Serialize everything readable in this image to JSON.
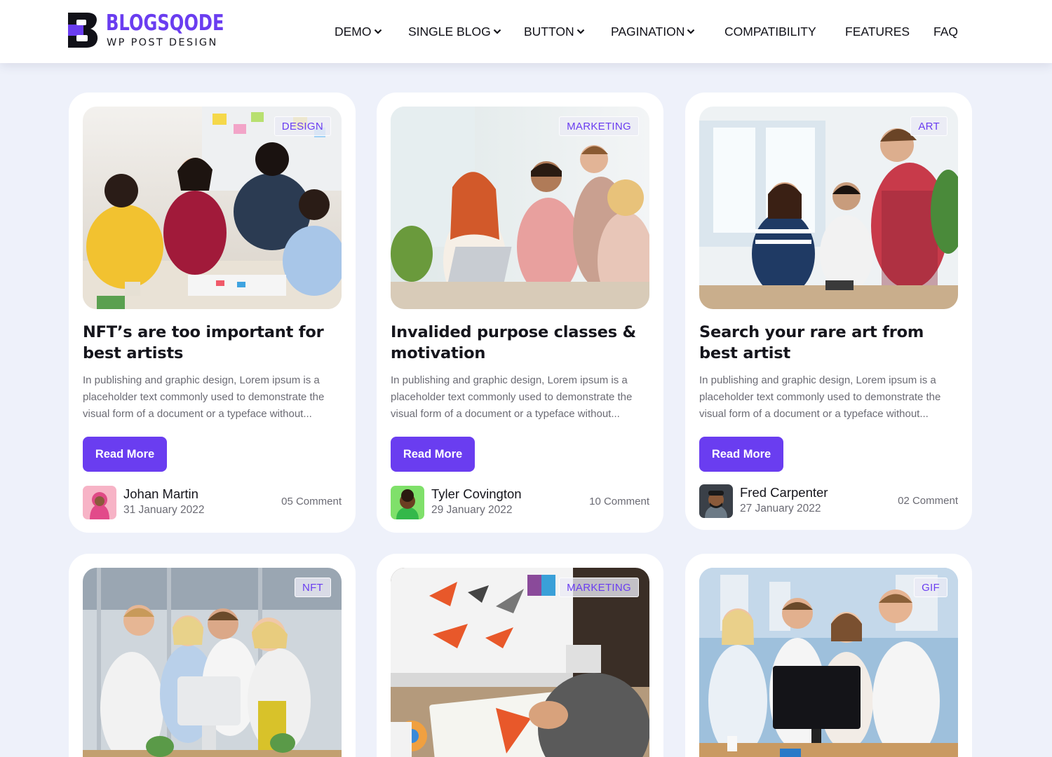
{
  "brand": {
    "title": "BLOGSQODE",
    "subtitle": "WP POST DESIGN",
    "accent": "#6a3df0"
  },
  "nav": [
    {
      "label": "DEMO",
      "dropdown": true
    },
    {
      "label": "SINGLE BLOG",
      "dropdown": true
    },
    {
      "label": "BUTTON",
      "dropdown": true
    },
    {
      "label": "PAGINATION",
      "dropdown": true
    },
    {
      "label": "COMPATIBILITY",
      "dropdown": false
    },
    {
      "label": "FEATURES",
      "dropdown": false
    },
    {
      "label": "FAQ",
      "dropdown": false
    }
  ],
  "posts": [
    {
      "category": "DESIGN",
      "title": "NFT’s are too important for best artists",
      "excerpt": "In publishing and graphic design, Lorem ipsum is a placeholder text commonly used to demonstrate the visual form of a document or a typeface without...",
      "button": "Read More",
      "author": "Johan Martin",
      "date": "31 January 2022",
      "comments": "05 Comment"
    },
    {
      "category": "MARKETING",
      "title": "Invalided purpose classes & motivation",
      "excerpt": "In publishing and graphic design, Lorem ipsum is a placeholder text commonly used to demonstrate the visual form of a document or a typeface without...",
      "button": "Read More",
      "author": "Tyler Covington",
      "date": "29 January 2022",
      "comments": "10 Comment"
    },
    {
      "category": "ART",
      "title": "Search your rare art from best artist",
      "excerpt": "In publishing and graphic design, Lorem ipsum is a placeholder text commonly used to demonstrate the visual form of a document or a typeface without...",
      "button": "Read More",
      "author": "Fred Carpenter",
      "date": "27 January 2022",
      "comments": "02 Comment"
    },
    {
      "category": "NFT"
    },
    {
      "category": "MARKETING"
    },
    {
      "category": "GIF"
    }
  ]
}
